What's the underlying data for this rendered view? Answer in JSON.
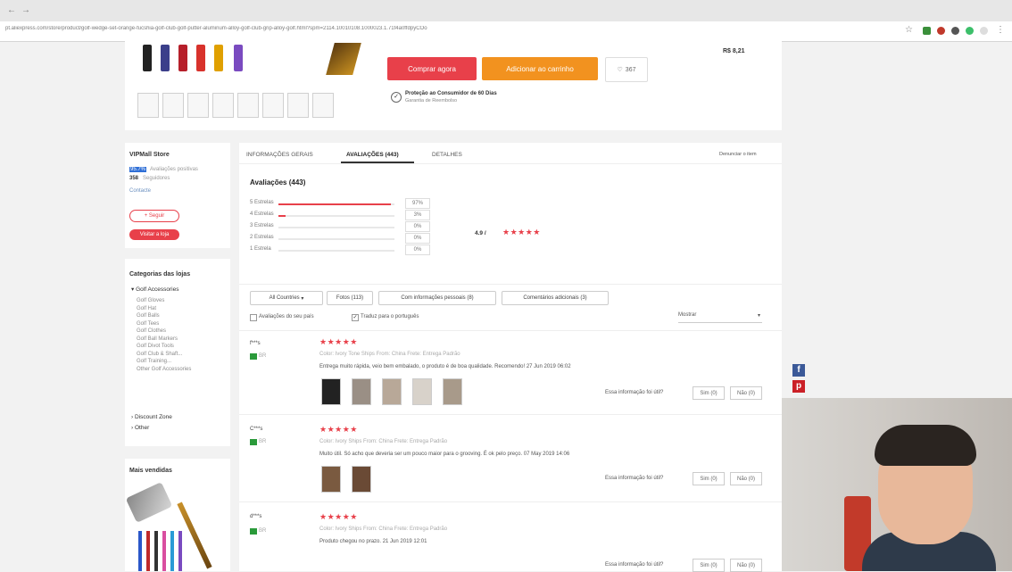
{
  "browser": {
    "url": "pt.aliexpress.com/store/product/golf-wedge-set-orange-fucshia-golf-club-golf-putter-aluminum-alloy-golf-club-grip-alloy-golf.html?spm=2114.10010108.1000023.1.71f4a0ffdpyCOo"
  },
  "product": {
    "price_note": "R$ 8,21",
    "buy_now": "Comprar agora",
    "add_to_cart": "Adicionar ao carrinho",
    "wishlist_count": "367",
    "protection_title": "Proteção ao Consumidor de 60 Dias",
    "protection_sub": "Garantia de Reembolso"
  },
  "store": {
    "name": "VIPMall Store",
    "feedback_pct": "95.7%",
    "feedback_label": "Avaliações positivas",
    "followers": "358",
    "followers_label": "Seguidores",
    "contact": "Contacte",
    "follow_button": "+ Seguir",
    "visit_button": "Visitar a loja"
  },
  "categories": {
    "title": "Categorias das lojas",
    "group": "Golf Accessories",
    "items": [
      "Golf Gloves",
      "Golf Hat",
      "Golf Balls",
      "Golf Tees",
      "Golf Clothes",
      "Golf Ball Markers",
      "Golf Divot Tools",
      "Golf Club & Shaft...",
      "Golf Training...",
      "Other Golf Accessories"
    ],
    "discount": "Discount Zone",
    "other": "Other"
  },
  "bestsellers": {
    "title": "Mais vendidas"
  },
  "tabs": {
    "info": "INFORMAÇÕES GERAIS",
    "reviews": "AVALIAÇÕES (443)",
    "details": "DETALHES",
    "report": "Denunciar o item"
  },
  "ratings": {
    "title": "Avaliações (443)",
    "score": "4.9 /",
    "score_stars": "★★★★★",
    "rows": [
      {
        "label": "5 Estrelas",
        "pct": "97%",
        "fill": 0.97
      },
      {
        "label": "4 Estrelas",
        "pct": "3%",
        "fill": 0.03
      },
      {
        "label": "3 Estrelas",
        "pct": "0%",
        "fill": 0
      },
      {
        "label": "2 Estrelas",
        "pct": "0%",
        "fill": 0
      },
      {
        "label": "1 Estrela",
        "pct": "0%",
        "fill": 0
      }
    ]
  },
  "filters": {
    "countries": "All Countries",
    "photos": "Fotos (113)",
    "additional": "Com informações pessoais (8)",
    "comments": "Comentários adicionais (3)",
    "your_country": "Avaliações do seu país",
    "translate": "Traduz para o português",
    "sort": "Mostrar"
  },
  "reviews": [
    {
      "user": "f***s",
      "country": "BR",
      "stars": "★★★★★",
      "meta": "Color: Ivory Tone  Ships From: China  Frete: Entrega Padrão",
      "text": "Entrega muito rápida, veio bem embalado, o produto é de boa qualidade. Recomendo! 27 Jun 2019 06:02",
      "helpful": "Essa informação foi útil?",
      "yes": "Sim (0)",
      "no": "Não (0)"
    },
    {
      "user": "C***s",
      "country": "BR",
      "stars": "★★★★★",
      "meta": "Color: Ivory  Ships From: China  Frete: Entrega Padrão",
      "text": "Muito útil. Só acho que deveria ser um pouco maior para o grooving. É ok pelo preço. 07 May 2019 14:06",
      "helpful": "Essa informação foi útil?",
      "yes": "Sim (0)",
      "no": "Não (0)"
    },
    {
      "user": "d***s",
      "country": "BR",
      "stars": "★★★★★",
      "meta": "Color: Ivory  Ships From: China  Frete: Entrega Padrão",
      "text": "Produto chegou no prazo. 21 Jun 2019 12:01",
      "helpful": "Essa informação foi útil?",
      "yes": "Sim (0)",
      "no": "Não (0)"
    }
  ],
  "colors": {
    "accent": "#e8404a",
    "orange": "#f2921f"
  }
}
